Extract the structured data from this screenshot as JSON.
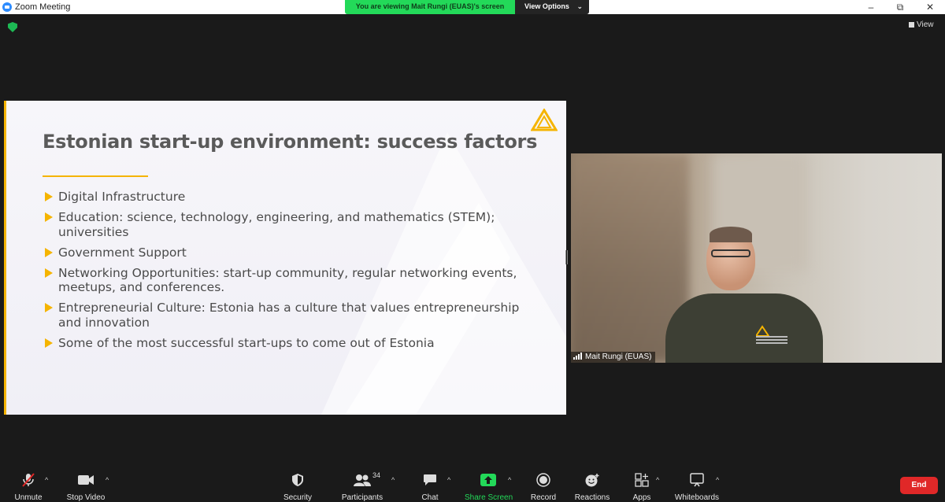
{
  "window": {
    "title": "Zoom Meeting",
    "controls": {
      "minimize": "–",
      "maximize": "⧉",
      "close": "✕"
    }
  },
  "share_banner": {
    "viewing_text": "You are viewing Mait Rungi (EUAS)'s screen",
    "view_options_label": "View Options",
    "view_options_chevron": "⌄"
  },
  "top_right": {
    "view_label": "View"
  },
  "colors": {
    "accent_yellow": "#f5b400",
    "share_green": "#23d959",
    "end_red": "#e02828",
    "background": "#1a1a1a"
  },
  "slide": {
    "title": "Estonian start-up environment: success factors",
    "bullets": [
      "Digital Infrastructure",
      "Education: science, technology, engineering, and mathematics (STEM); universities",
      "Government Support",
      "Networking Opportunities: start-up community, regular networking events, meetups, and conferences.",
      "Entrepreneurial Culture: Estonia has a culture that values entrepreneurship and innovation",
      "Some of the most successful start-ups to come out of Estonia"
    ]
  },
  "participant_video": {
    "name": "Mait Rungi (EUAS)"
  },
  "toolbar": {
    "unmute": "Unmute",
    "stop_video": "Stop Video",
    "security": "Security",
    "participants": "Participants",
    "participants_count": "34",
    "chat": "Chat",
    "share_screen": "Share Screen",
    "record": "Record",
    "reactions": "Reactions",
    "apps": "Apps",
    "whiteboards": "Whiteboards",
    "end": "End",
    "caret": "^"
  }
}
